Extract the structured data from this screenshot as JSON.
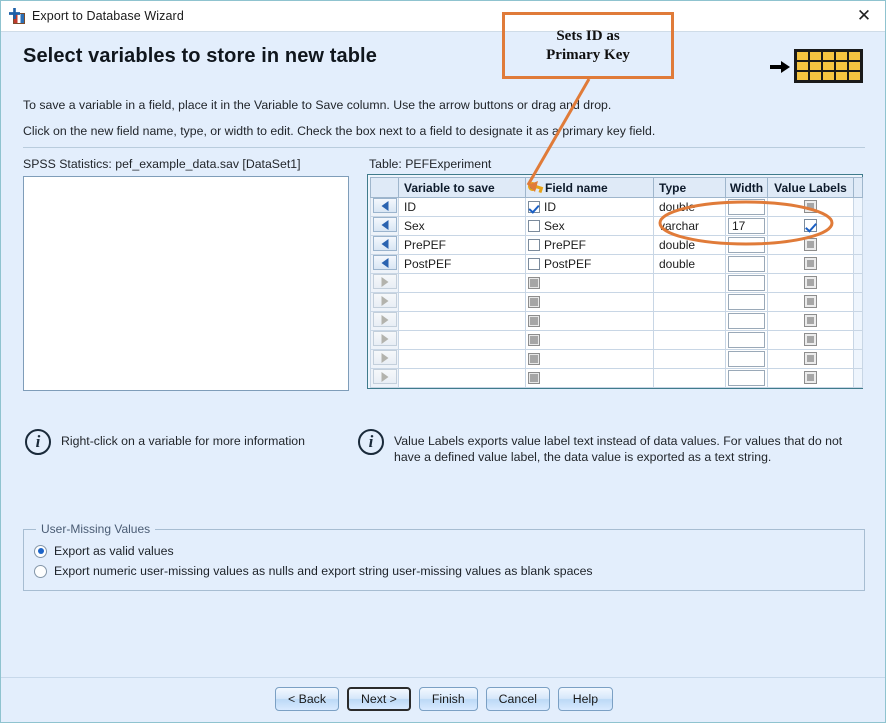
{
  "window": {
    "title": "Export to Database Wizard",
    "icon": "spss-export-icon",
    "close_label": "✕"
  },
  "header": {
    "page_title": "Select variables to store in new table",
    "instruction_line1": "To save a variable in a field, place it in the Variable to Save column. Use the arrow buttons or drag and drop.",
    "instruction_line2": "Click on the new field name, type, or width to edit. Check the box next to a field to designate it as a primary key field.",
    "step_icon": "arrow-to-table-icon",
    "step_icon_color": "#f5c440"
  },
  "source": {
    "label": "SPSS Statistics:  pef_example_data.sav [DataSet1]",
    "list_items": []
  },
  "table_panel": {
    "label": "Table: PEFExperiment",
    "columns": [
      "",
      "Variable to save",
      "Field name",
      "Type",
      "Width",
      "Value Labels"
    ],
    "key_icon": "primary-key-icon",
    "rows": [
      {
        "arrow": "left",
        "arrow_enabled": true,
        "variable": "ID",
        "pk_checked": true,
        "pk_enabled": true,
        "field": "ID",
        "type": "double",
        "width": "",
        "value_labels_checked": false,
        "value_labels_enabled": false
      },
      {
        "arrow": "left",
        "arrow_enabled": true,
        "variable": "Sex",
        "pk_checked": false,
        "pk_enabled": true,
        "field": "Sex",
        "type": "varchar",
        "width": "17",
        "value_labels_checked": true,
        "value_labels_enabled": true
      },
      {
        "arrow": "left",
        "arrow_enabled": true,
        "variable": "PrePEF",
        "pk_checked": false,
        "pk_enabled": true,
        "field": "PrePEF",
        "type": "double",
        "width": "",
        "value_labels_checked": false,
        "value_labels_enabled": false
      },
      {
        "arrow": "left",
        "arrow_enabled": true,
        "variable": "PostPEF",
        "pk_checked": false,
        "pk_enabled": true,
        "field": "PostPEF",
        "type": "double",
        "width": "",
        "value_labels_checked": false,
        "value_labels_enabled": false
      },
      {
        "arrow": "right",
        "arrow_enabled": false,
        "variable": "",
        "pk_checked": false,
        "pk_enabled": false,
        "field": "",
        "type": "",
        "width": "",
        "value_labels_checked": false,
        "value_labels_enabled": false
      },
      {
        "arrow": "right",
        "arrow_enabled": false,
        "variable": "",
        "pk_checked": false,
        "pk_enabled": false,
        "field": "",
        "type": "",
        "width": "",
        "value_labels_checked": false,
        "value_labels_enabled": false
      },
      {
        "arrow": "right",
        "arrow_enabled": false,
        "variable": "",
        "pk_checked": false,
        "pk_enabled": false,
        "field": "",
        "type": "",
        "width": "",
        "value_labels_checked": false,
        "value_labels_enabled": false
      },
      {
        "arrow": "right",
        "arrow_enabled": false,
        "variable": "",
        "pk_checked": false,
        "pk_enabled": false,
        "field": "",
        "type": "",
        "width": "",
        "value_labels_checked": false,
        "value_labels_enabled": false
      },
      {
        "arrow": "right",
        "arrow_enabled": false,
        "variable": "",
        "pk_checked": false,
        "pk_enabled": false,
        "field": "",
        "type": "",
        "width": "",
        "value_labels_checked": false,
        "value_labels_enabled": false
      },
      {
        "arrow": "right",
        "arrow_enabled": false,
        "variable": "",
        "pk_checked": false,
        "pk_enabled": false,
        "field": "",
        "type": "",
        "width": "",
        "value_labels_checked": false,
        "value_labels_enabled": false
      }
    ]
  },
  "notes": {
    "note1": "Right-click on a variable for more information",
    "note2_line1": "Value Labels exports value label text instead of data values. For values that do not",
    "note2_line2": "have a defined value label, the data value is exported as a text string."
  },
  "user_missing": {
    "group_title": "User-Missing Values",
    "option1": "Export as valid values",
    "option2": "Export numeric user-missing values as nulls and export string user-missing values as blank spaces",
    "selected": 0
  },
  "buttons": {
    "back": "< Back",
    "next": "Next >",
    "finish": "Finish",
    "cancel": "Cancel",
    "help": "Help",
    "focused": "next"
  },
  "annotation": {
    "text_line1": "Sets ID as",
    "text_line2": "Primary Key",
    "color": "#e07b39"
  }
}
